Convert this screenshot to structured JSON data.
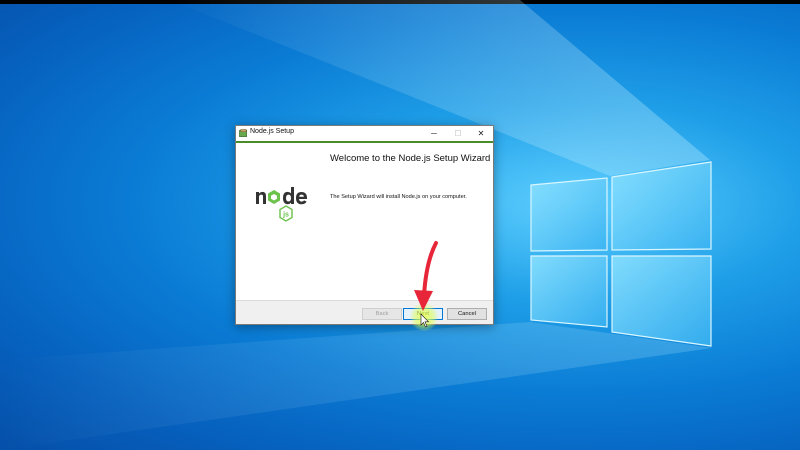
{
  "desktop": {
    "wallpaper": "windows-10-blue",
    "logo_icon": "windows-logo-icon"
  },
  "dialog": {
    "title": "Node.js Setup",
    "app_icon": "nodejs-installer-icon",
    "window_controls": {
      "minimize": "─",
      "maximize": "☐",
      "close": "✕"
    },
    "heading": "Welcome to the Node.js Setup Wizard",
    "description": "The Setup Wizard will install Node.js on your computer.",
    "logo": "nodejs-logo",
    "buttons": {
      "back": "Back",
      "next": "Next",
      "cancel": "Cancel"
    },
    "colors": {
      "accent_line": "#4a8c2a",
      "next_border": "#0078d7"
    }
  },
  "annotation": {
    "arrow_icon": "red-arrow-pointer-icon",
    "arrow_color": "#e8263a",
    "highlight_color": "#e6ff5a"
  }
}
